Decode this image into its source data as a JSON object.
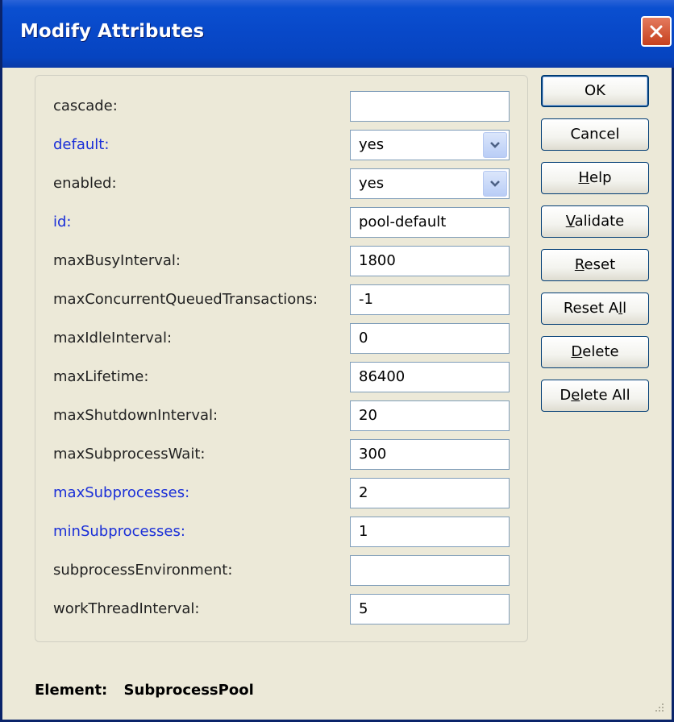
{
  "window": {
    "title": "Modify Attributes"
  },
  "fields": [
    {
      "label": "cascade:",
      "type": "text",
      "value": "",
      "required": false
    },
    {
      "label": "default:",
      "type": "select",
      "value": "yes",
      "required": true
    },
    {
      "label": "enabled:",
      "type": "select",
      "value": "yes",
      "required": false
    },
    {
      "label": "id:",
      "type": "text",
      "value": "pool-default",
      "required": true
    },
    {
      "label": "maxBusyInterval:",
      "type": "text",
      "value": "1800",
      "required": false
    },
    {
      "label": "maxConcurrentQueuedTransactions:",
      "type": "text",
      "value": "-1",
      "required": false
    },
    {
      "label": "maxIdleInterval:",
      "type": "text",
      "value": "0",
      "required": false
    },
    {
      "label": "maxLifetime:",
      "type": "text",
      "value": "86400",
      "required": false
    },
    {
      "label": "maxShutdownInterval:",
      "type": "text",
      "value": "20",
      "required": false
    },
    {
      "label": "maxSubprocessWait:",
      "type": "text",
      "value": "300",
      "required": false
    },
    {
      "label": "maxSubprocesses:",
      "type": "text",
      "value": "2",
      "required": true
    },
    {
      "label": "minSubprocesses:",
      "type": "text",
      "value": "1",
      "required": true
    },
    {
      "label": "subprocessEnvironment:",
      "type": "text",
      "value": "",
      "required": false
    },
    {
      "label": "workThreadInterval:",
      "type": "text",
      "value": "5",
      "required": false
    }
  ],
  "buttons": [
    {
      "label": "OK",
      "mnemonic": ""
    },
    {
      "label": "Cancel",
      "mnemonic": ""
    },
    {
      "label": "Help",
      "mnemonic": "H"
    },
    {
      "label": "Validate",
      "mnemonic": "V"
    },
    {
      "label": "Reset",
      "mnemonic": "R"
    },
    {
      "label": "Reset All",
      "mnemonic": "l"
    },
    {
      "label": "Delete",
      "mnemonic": "D"
    },
    {
      "label": "Delete All",
      "mnemonic": "e"
    }
  ],
  "status": {
    "label": "Element:",
    "value": "SubprocessPool"
  },
  "colors": {
    "required_label": "#1a2fd8",
    "title_bar": "#0848c8"
  },
  "icons": {
    "close": "close-icon",
    "dropdown": "chevron-down-icon",
    "resize": "resize-grip-icon"
  }
}
